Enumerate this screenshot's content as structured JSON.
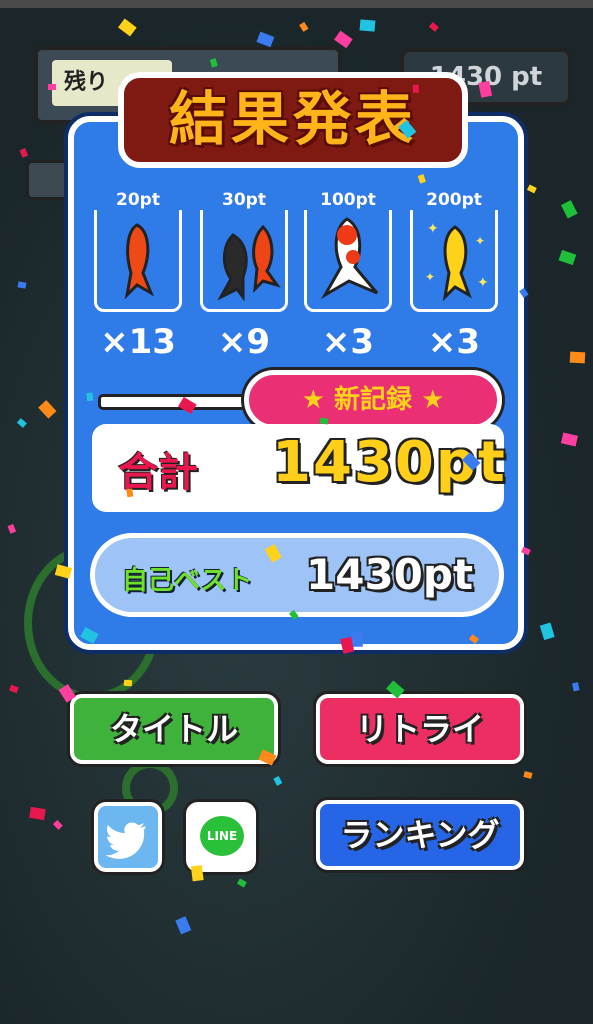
{
  "hud": {
    "timer_label": "残り",
    "score_text": "1430 pt"
  },
  "result": {
    "title": "結果発表",
    "fish_cards": [
      {
        "points": "20pt",
        "count": "×13",
        "fish": "red-goldfish-icon"
      },
      {
        "points": "30pt",
        "count": "×9",
        "fish": "black-red-goldfish-icon"
      },
      {
        "points": "100pt",
        "count": "×3",
        "fish": "white-red-goldfish-icon"
      },
      {
        "points": "200pt",
        "count": "×3",
        "fish": "golden-goldfish-icon"
      }
    ],
    "new_record": "新記録",
    "total_label": "合計",
    "total_value": "1430pt",
    "best_label": "自己ベスト",
    "best_value": "1430pt"
  },
  "buttons": {
    "title": "タイトル",
    "retry": "リトライ",
    "ranking": "ランキング",
    "twitter": "twitter-bird-icon",
    "line": "LINE"
  },
  "colors": {
    "panel_blue": "#2f7be8",
    "title_orange": "#ffb41a",
    "record_pink": "#ea2f74",
    "total_red": "#e8184f",
    "score_yellow": "#ffcf1a",
    "title_button_green": "#3fb23b",
    "retry_button_pink": "#ec2e62",
    "ranking_button_blue": "#2666e6"
  }
}
